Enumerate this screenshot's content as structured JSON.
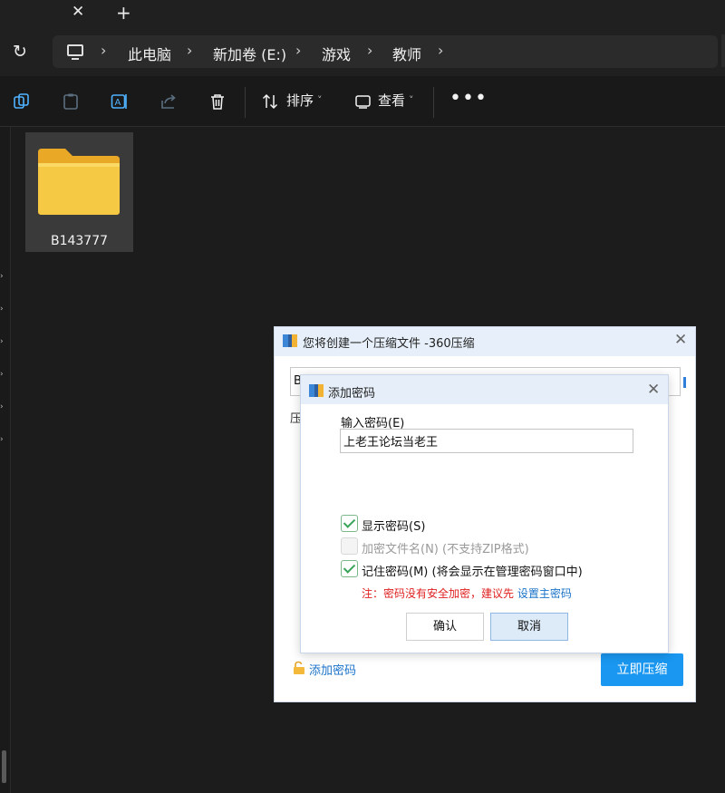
{
  "tabs": {
    "close_glyph": "✕",
    "new_tab_glyph": "+"
  },
  "address": {
    "refresh_glyph": "↻",
    "crumbs": [
      "此电脑",
      "新加卷 (E:)",
      "游戏",
      "教师"
    ],
    "chevron": "›"
  },
  "toolbar": {
    "sort_label": "排序",
    "view_label": "查看",
    "more_glyph": "•••",
    "dropdown_glyph": "˅"
  },
  "folder": {
    "name": "B143777"
  },
  "outer_dialog": {
    "title": "您将创建一个压缩文件 -360压缩",
    "field_text": "B",
    "label_cut": "压",
    "add_password_link": "添加密码",
    "compress_button": "立即压缩",
    "close_glyph": "✕"
  },
  "inner_dialog": {
    "title": "添加密码",
    "password_label": "输入密码(E)",
    "password_value": "上老王论坛当老王",
    "show_password": "显示密码(S)",
    "encrypt_filename": "加密文件名(N) (不支持ZIP格式)",
    "remember_password": "记住密码(M) (将会显示在管理密码窗口中)",
    "note_prefix": "注：密码没有安全加密，建议先 ",
    "note_link": "设置主密码",
    "ok_button": "确认",
    "cancel_button": "取消",
    "close_glyph": "✕",
    "show_password_checked": true,
    "encrypt_filename_checked": false,
    "encrypt_filename_enabled": false,
    "remember_password_checked": true
  },
  "colors": {
    "accent": "#1a97f0",
    "folder": "#f6c945",
    "check": "#3aa55a",
    "warning": "#e02020",
    "link": "#1a73c9"
  }
}
